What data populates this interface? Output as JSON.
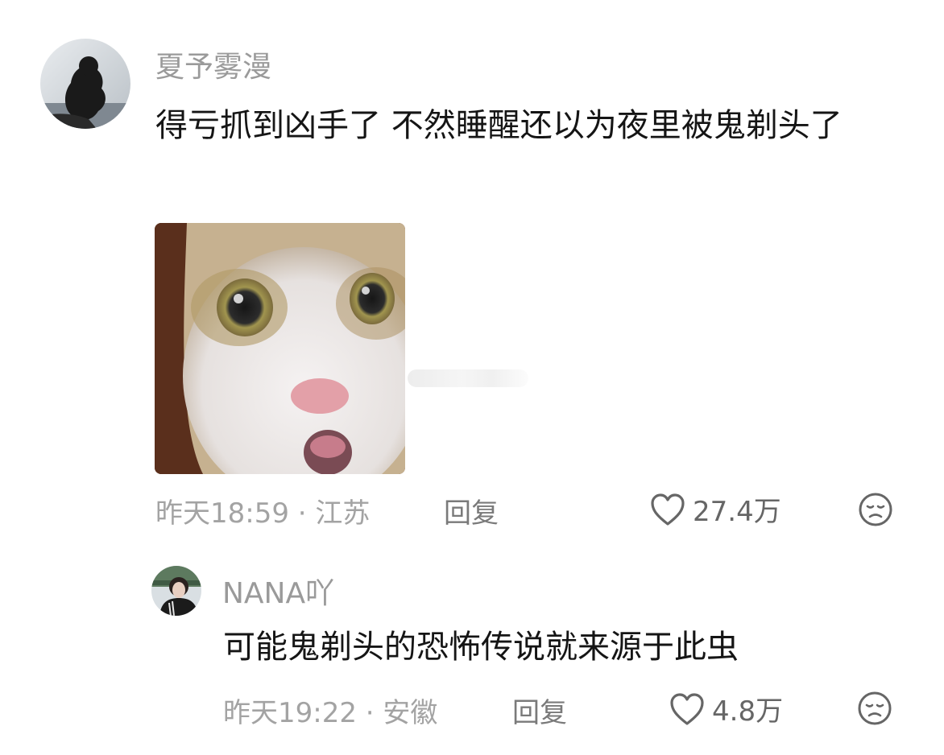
{
  "comments": [
    {
      "username": "夏予雾漫",
      "text": "得亏抓到凶手了 不然睡醒还以为夜里被鬼剃头了",
      "time": "昨天18:59",
      "location": "江苏",
      "separator": " · ",
      "reply_label": "回复",
      "likes": "27.4万",
      "icons": [
        "avatar",
        "sticker-shocked-cat",
        "heart-icon",
        "dislike-face-icon"
      ]
    }
  ],
  "replies": [
    {
      "username": "NANA吖",
      "text": "可能鬼剃头的恐怖传说就来源于此虫",
      "time": "昨天19:22",
      "location": "安徽",
      "separator": " · ",
      "reply_label": "回复",
      "likes": "4.8万",
      "icons": [
        "avatar",
        "heart-icon",
        "dislike-face-icon"
      ]
    }
  ],
  "colors": {
    "username": "#9a9a9a",
    "content": "#151515",
    "meta": "#a3a3a3",
    "icon": "#666666"
  }
}
